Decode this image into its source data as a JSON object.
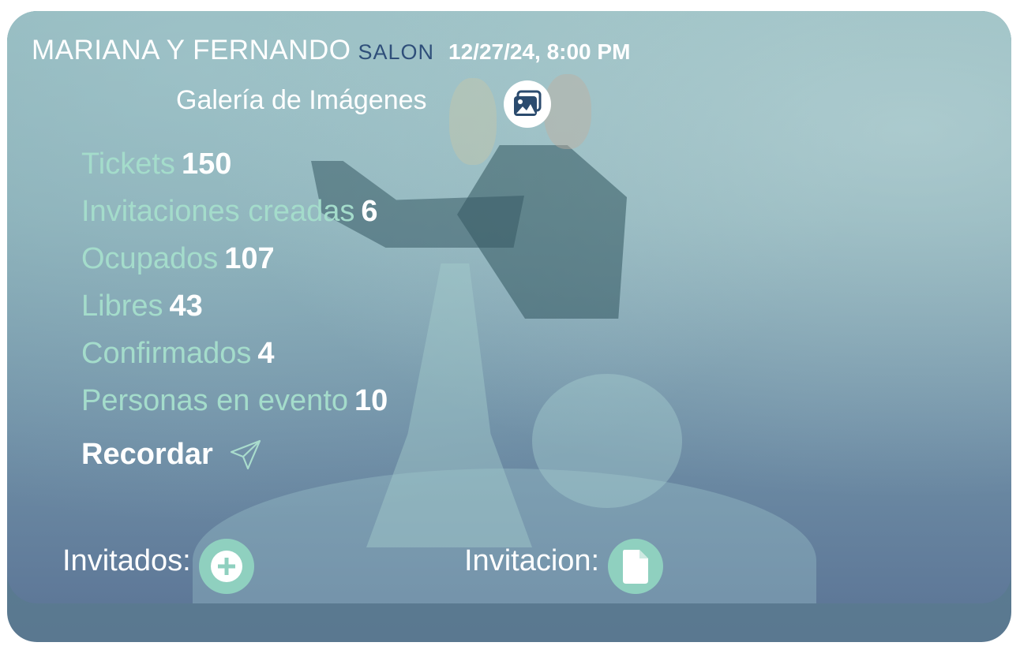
{
  "event": {
    "couple": "MARIANA Y FERNANDO",
    "venue": "SALON",
    "datetime": "12/27/24, 8:00 PM"
  },
  "gallery": {
    "label": "Galería de Imágenes",
    "icon": "image-gallery-icon"
  },
  "stats": [
    {
      "label": "Tickets",
      "value": "150"
    },
    {
      "label": "Invitaciones creadas",
      "value": "6"
    },
    {
      "label": "Ocupados",
      "value": "107"
    },
    {
      "label": "Libres",
      "value": "43"
    },
    {
      "label": "Confirmados",
      "value": "4"
    },
    {
      "label": "Personas en evento",
      "value": "10"
    }
  ],
  "remind": {
    "label": "Recordar",
    "icon": "send-icon"
  },
  "footer": {
    "guests_label": "Invitados:",
    "guests_icon": "plus-circle-icon",
    "invitation_label": "Invitacion:",
    "invitation_icon": "document-icon"
  },
  "colors": {
    "stat_label": "#a4dccb",
    "accent_button": "#8fd0bf",
    "venue_text": "#2f4f7a"
  }
}
